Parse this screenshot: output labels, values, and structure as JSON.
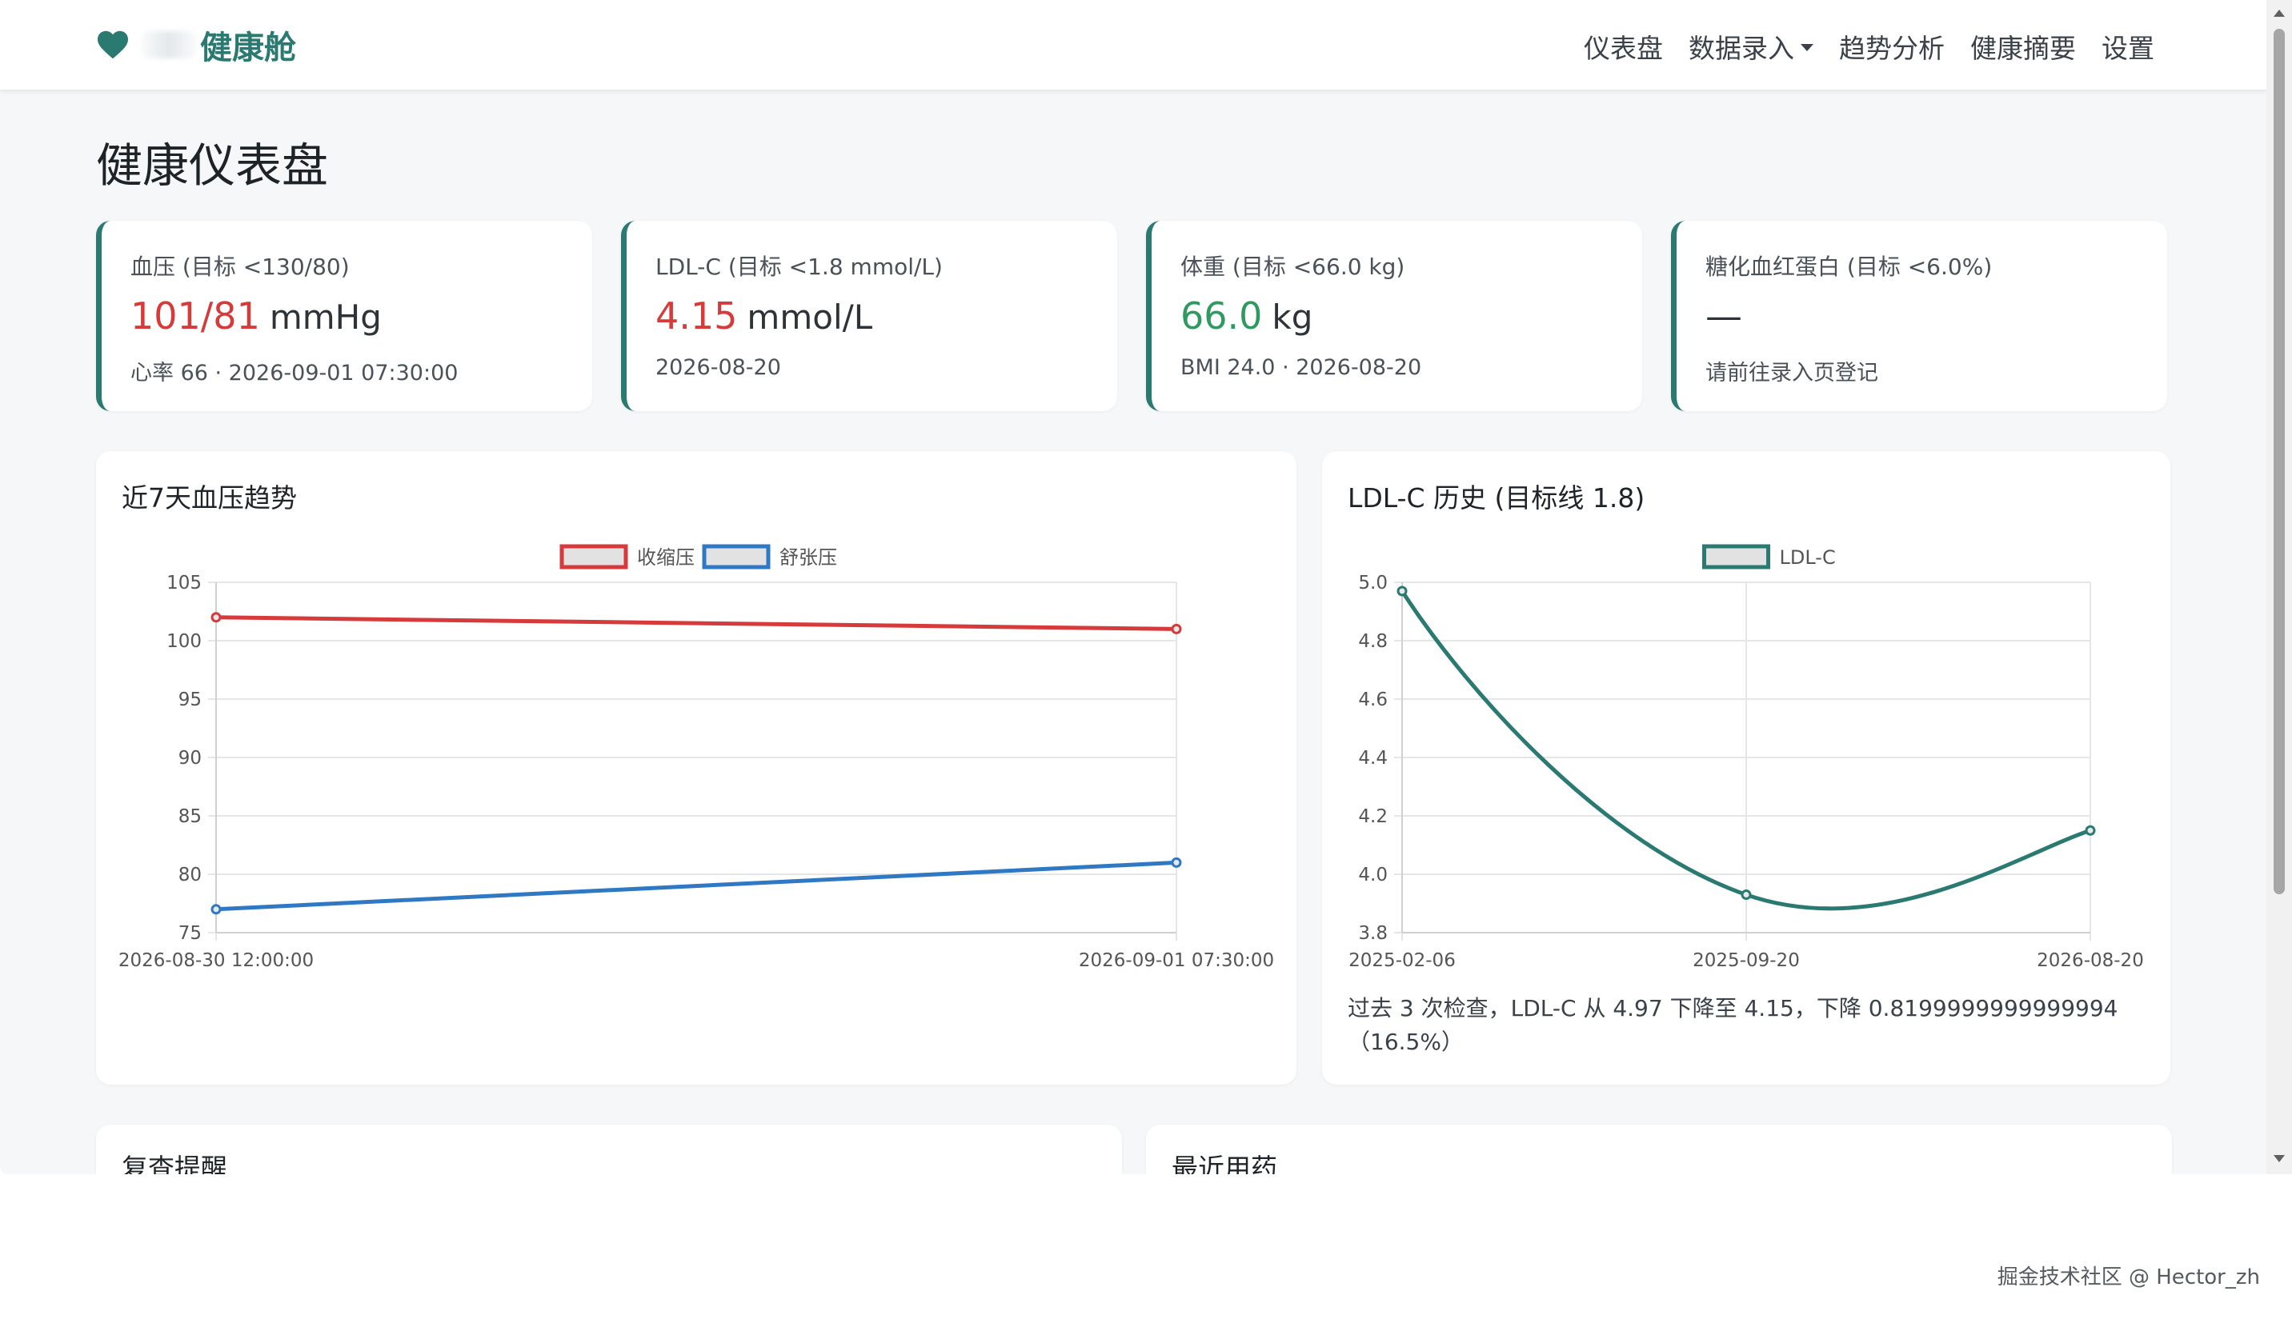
{
  "nav": {
    "brand_visible": "健康舱",
    "links": [
      {
        "label": "仪表盘"
      },
      {
        "label": "数据录入",
        "dropdown": true
      },
      {
        "label": "趋势分析"
      },
      {
        "label": "健康摘要"
      },
      {
        "label": "设置"
      }
    ]
  },
  "page_title": "健康仪表盘",
  "stats": [
    {
      "label": "血压 (目标 <130/80)",
      "value": "101/81",
      "unit": "mmHg",
      "sub": "心率 66 · 2026-09-01 07:30:00",
      "value_color": "#d63a3a"
    },
    {
      "label": "LDL-C (目标 <1.8 mmol/L)",
      "value": "4.15",
      "unit": "mmol/L",
      "sub": "2026-08-20",
      "value_color": "#d63a3a"
    },
    {
      "label": "体重 (目标 <66.0 kg)",
      "value": "66.0",
      "unit": "kg",
      "sub": "BMI 24.0 · 2026-08-20",
      "value_color": "#2f9a5f"
    },
    {
      "label": "糖化血红蛋白 (目标 <6.0%)",
      "value": "—",
      "unit": "",
      "sub": "请前往录入页登记",
      "value_color": "#2e3338"
    }
  ],
  "colors": {
    "accent": "#2a7a72",
    "systolic": "#d63a3a",
    "diastolic": "#2f78c4",
    "ldl": "#2a7a72"
  },
  "bp_card": {
    "title": "近7天血压趋势"
  },
  "ldl_card": {
    "title": "LDL-C 历史 (目标线 1.8)",
    "note": "过去 3 次检查，LDL-C 从 4.97 下降至 4.15，下降 0.8199999999999994（16.5%）"
  },
  "chart_data": [
    {
      "type": "line",
      "title": "近7天血压趋势",
      "x": [
        "2026-08-30 12:00:00",
        "2026-09-01 07:30:00"
      ],
      "series": [
        {
          "name": "收缩压",
          "values": [
            102,
            101
          ]
        },
        {
          "name": "舒张压",
          "values": [
            77,
            81
          ]
        }
      ],
      "ylim": [
        75,
        105
      ],
      "yticks": [
        105,
        100,
        95,
        90,
        85,
        80,
        75
      ],
      "legend": "top-center",
      "grid": true
    },
    {
      "type": "line",
      "title": "LDL-C 历史 (目标线 1.8)",
      "x": [
        "2025-02-06",
        "2025-09-20",
        "2026-08-20"
      ],
      "series": [
        {
          "name": "LDL-C",
          "values": [
            4.97,
            3.93,
            4.15
          ]
        }
      ],
      "ylim": [
        3.8,
        5.0
      ],
      "yticks": [
        "5.0",
        "4.8",
        "4.6",
        "4.4",
        "4.2",
        "4.0",
        "3.8"
      ],
      "legend": "top-center",
      "grid": true,
      "smooth": true
    }
  ],
  "bottom": {
    "left_title": "复查提醒",
    "right_title": "最近用药"
  },
  "watermark": "掘金技术社区 @ Hector_zh"
}
